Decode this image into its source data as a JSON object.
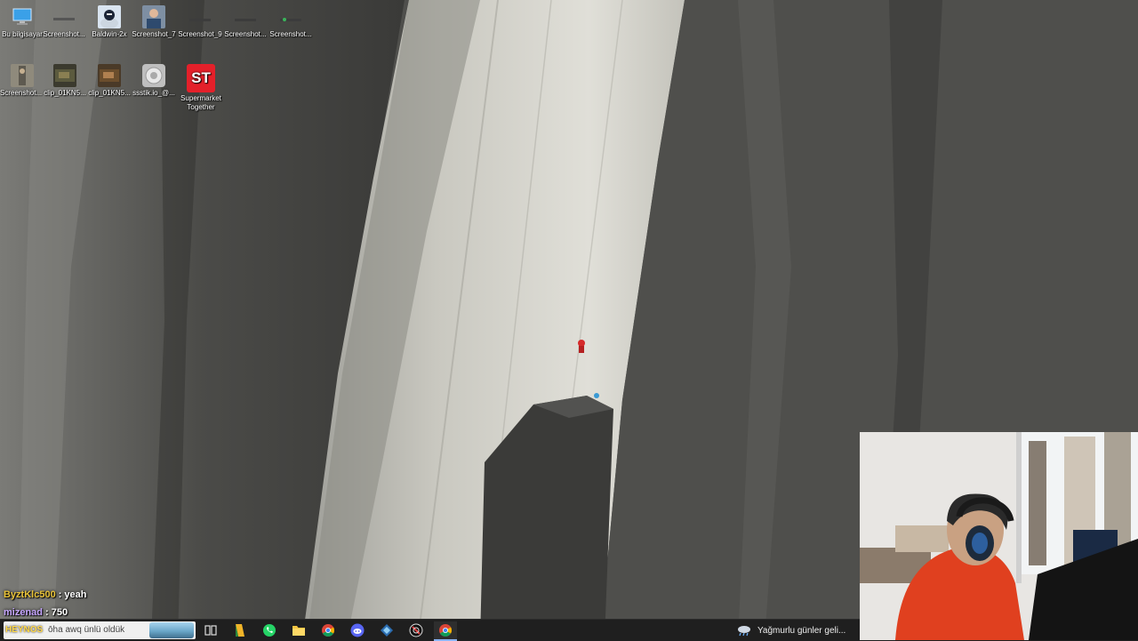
{
  "desktop": {
    "icons": [
      {
        "label": "Bu bilgisayar",
        "icon": "computer-icon"
      },
      {
        "label": "Screenshot...",
        "icon": "image-file-icon"
      },
      {
        "label": "Baldwin-2x",
        "icon": "image-file-icon"
      },
      {
        "label": "Screenshot_7",
        "icon": "image-file-icon"
      },
      {
        "label": "Screenshot_9",
        "icon": "image-file-icon"
      },
      {
        "label": "Screenshot...",
        "icon": "image-file-icon"
      },
      {
        "label": "Screenshot...",
        "icon": "image-file-icon"
      },
      {
        "label": "clip_01KN5...",
        "icon": "video-file-icon"
      },
      {
        "label": "clip_01KN5...",
        "icon": "video-file-icon"
      },
      {
        "label": "ssstik.io_@...",
        "icon": "video-file-icon"
      },
      {
        "label": "Supermarket Together",
        "icon": "supermarket-together-icon",
        "badge": "ST"
      }
    ]
  },
  "chat": {
    "messages": [
      {
        "user": "ByztKlc500",
        "text": ": yeah",
        "color": "#e8c238"
      },
      {
        "user": "mizenad",
        "text": ": 750",
        "color": "#c6a6ff"
      },
      {
        "user": "HEYNOS",
        "text": ": ōha awq ünlü oldük",
        "color": "#ffd84a"
      }
    ]
  },
  "taskbar": {
    "search_placeholder": "ōha awq ünlü oldük",
    "apps": [
      {
        "name": "task-view",
        "icon": "task-view-icon"
      },
      {
        "name": "app-yellow",
        "icon": "yellow-app-icon"
      },
      {
        "name": "whatsapp",
        "icon": "whatsapp-icon"
      },
      {
        "name": "file-explorer",
        "icon": "folder-icon"
      },
      {
        "name": "chrome",
        "icon": "chrome-icon"
      },
      {
        "name": "discord",
        "icon": "discord-icon"
      },
      {
        "name": "app-blue",
        "icon": "blue-app-icon"
      },
      {
        "name": "app-dark",
        "icon": "dark-app-icon"
      },
      {
        "name": "chrome-active",
        "icon": "chrome-icon"
      }
    ],
    "weather_text": "Yağmurlu günler geli..."
  },
  "colors": {
    "taskbar_bg": "#1f1f1f",
    "webcam_shirt": "#e0401f"
  }
}
